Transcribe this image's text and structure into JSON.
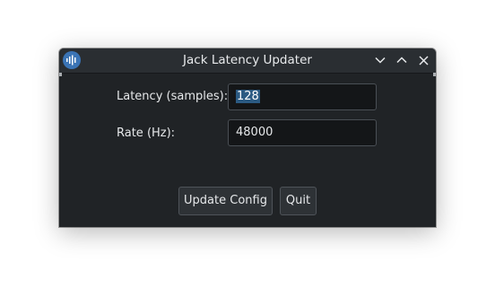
{
  "window": {
    "title": "Jack Latency Updater",
    "app_icon": "audio-waveform-icon"
  },
  "titlebar_buttons": {
    "minimize": "chevron-down-icon",
    "maximize": "chevron-up-icon",
    "close": "close-icon"
  },
  "form": {
    "latency_label": "Latency (samples):",
    "latency_value": "128",
    "rate_label": "Rate (Hz):",
    "rate_value": "48000"
  },
  "buttons": {
    "update_label": "Update Config",
    "quit_label": "Quit"
  },
  "colors": {
    "window_bg": "#202326",
    "titlebar_bg": "#2a2e32",
    "icon_accent": "#3b74b5",
    "selection": "#2b5a82"
  }
}
